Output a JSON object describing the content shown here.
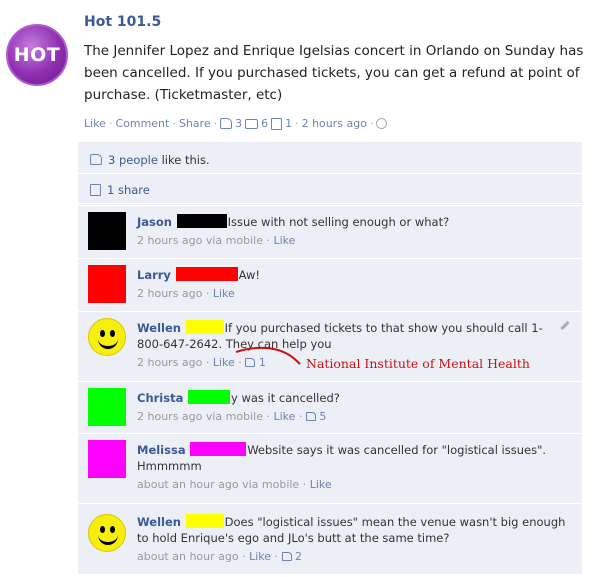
{
  "page": {
    "logo_text": "HOT",
    "name": "Hot 101.5",
    "post_text": "The Jennifer Lopez and Enrique Igelsias concert in Orlando on Sunday has been cancelled. If you purchased tickets, you can get a refund at point of purchase. (Ticketmaster, etc)"
  },
  "actions": {
    "like": "Like",
    "comment": "Comment",
    "share": "Share",
    "likes_count": "3",
    "comments_count": "6",
    "shares_count": "1",
    "timestamp": "2 hours ago"
  },
  "feedback": {
    "likes_text": "3 people",
    "likes_suffix": "like this.",
    "shares_text": "1 share"
  },
  "comments": [
    {
      "name": "Jason",
      "redact_color": "#000000",
      "text": "Issue with not selling enough or what?",
      "meta_time": "2 hours ago via mobile",
      "like": "Like",
      "likes": ""
    },
    {
      "name": "Larry",
      "redact_color": "#ff0000",
      "text": "Aw!",
      "meta_time": "2 hours ago",
      "like": "Like",
      "likes": ""
    },
    {
      "name": "Wellen",
      "redact_color": "#ffff00",
      "text": "If you purchased tickets to that show you should call 1-800-647-2642. They can help you",
      "meta_time": "2 hours ago",
      "like": "Like",
      "likes": "1"
    },
    {
      "name": "Christa",
      "redact_color": "#00ff00",
      "text": "y was it cancelled?",
      "meta_time": "2 hours ago via mobile",
      "like": "Like",
      "likes": "5"
    },
    {
      "name": "Melissa",
      "redact_color": "#ff00ff",
      "text": "Website says it was cancelled for \"logistical issues\". Hmmmmm",
      "meta_time": "about an hour ago via mobile",
      "like": "Like",
      "likes": ""
    },
    {
      "name": "Wellen",
      "redact_color": "#ffff00",
      "text": "Does \"logistical issues\" mean the venue wasn't big enough to hold Enrique's ego and JLo's butt at the same time?",
      "meta_time": "about an hour ago",
      "like": "Like",
      "likes": "2"
    }
  ],
  "annotation": "National Institute of Mental Health",
  "colors": {
    "link": "#3b5998",
    "feedback_bg": "#eceff5",
    "annotation": "#cc1111"
  }
}
